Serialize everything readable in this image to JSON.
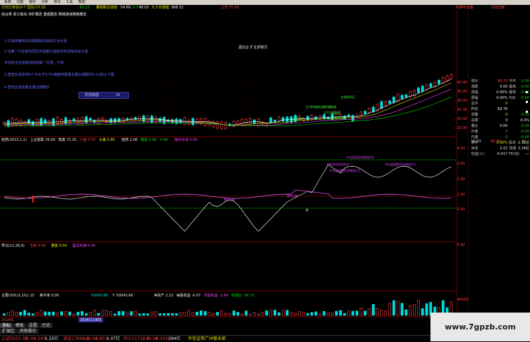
{
  "menu": [
    "系统",
    "功能",
    "报价",
    "分析",
    "资讯",
    "工具",
    "帮助"
  ],
  "titlebar": {
    "code_name": "方向万家信(0-7 国信)70.20",
    "change": "-62.21",
    "concept": "量锐新主动线",
    "price1": "54.69",
    "label2": "三十",
    "price2": "48.02",
    "label3": "九十日涨幅",
    "price3": "368.32",
    "state": "上日 75.65",
    "right_link": "实用平台版",
    "right_link2": "万向万家"
  },
  "subtitle": "综合类 浙江板块 涉矿概念 重组概念 网络游戏网络概念",
  "notes": [
    "1.只有政策利好的题题板块启动才会大涨",
    "2.当某一行业板块同比利润额大幅增长时该板块会大涨",
    "无利好无业绩板块启动是一日游，不追",
    "3.营收业绩增长6个点大于0.3%偶盘地量量业量台顺期印0.13倍以下量",
    "4.营收业绩增量业量台顺期印"
  ],
  "center_note": "酒店业 扩业梦破灭",
  "button_box": {
    "label": "厚层截图",
    "value": "35"
  },
  "chart_annotations": [
    "主力抄底超出最多最新底",
    "主力大幅抽高",
    "新不再生",
    "主力资金抽回",
    "庄家新多见"
  ],
  "price_axis": [
    "40.00",
    "35.00",
    "30.00",
    "25.00",
    "20.00",
    "15.00"
  ],
  "osc_axis": [
    "4.00",
    "3.00",
    "2.00",
    "1.00",
    "0.00"
  ],
  "osc_header": {
    "name": "趋势(2013,1,1)",
    "f1": "上证涨跌 76.00",
    "f2": "角度 72.35",
    "f3": "小盘 0.97",
    "f4": "大盘 0.95",
    "f5": "趋势 2.06",
    "f6": "量能 3.80",
    "f7": "3.40",
    "f8": "绝对长线 0.00"
  },
  "osc_labels": [
    "中长盘高资金增加信号",
    "机构资金进场加仓",
    "中长盘超跌资金增加信号",
    "中长盘超跌资金增加信号"
  ],
  "osc_small_labels": [
    "猪伤出屠",
    "猪伤出屠",
    "笑"
  ],
  "ind2_header": {
    "name": "乖马(12,26,9)",
    "f1": "五彩 0.00",
    "f2": "量能 0.00",
    "f3": "猛龙出海 0.00"
  },
  "ind2_axis": [
    "0.00"
  ],
  "vol_header": {
    "name": "主要(VOL(5,10)) 15",
    "f1": "换手率 0.00",
    "f2": "50043.66",
    "f3": "十 50043.66",
    "f4": "净资产 2.22",
    "f5": "每股收益 -0.07",
    "f6": "市盈收益 -1.84",
    "f7": "利润比 -34.72"
  },
  "vol_axis": [
    "40000"
  ],
  "date_axis": [
    "2014年",
    "2014/11/6日"
  ],
  "tabs": [
    "指标",
    "模板",
    "设置",
    "历史"
  ],
  "tabs2": [
    "扩展区",
    "关联报价"
  ],
  "side": {
    "rows": [
      {
        "k": "现价",
        "v": "69.78",
        "vc": "red",
        "k2": "今开",
        "v2": "-0.00",
        "v2c": "green"
      },
      {
        "k": "涨跌",
        "v": "0.00",
        "vc": "white",
        "k2": "最高",
        "v2": "-0.00",
        "v2c": "green"
      },
      {
        "k": "涨幅",
        "v": "0.00%",
        "vc": "white",
        "k2": "最低",
        "v2": "-0.00",
        "v2c": "green"
      },
      {
        "k": "振幅",
        "v": "0.00%",
        "vc": "white",
        "k2": "均价",
        "v2": "-0.00",
        "v2c": "green"
      },
      {
        "k": "总手",
        "v": "0",
        "vc": "yel",
        "k2": "",
        "v2": "",
        "v2c": "white"
      },
      {
        "k": "昨收",
        "v": "69.78",
        "vc": "white",
        "k2": "",
        "v2": "",
        "v2c": "white"
      },
      {
        "k": "现量",
        "v": "0",
        "vc": "yel",
        "k2": "",
        "v2": "-0.00",
        "v2c": "green"
      },
      {
        "k": "总额",
        "v": "0",
        "vc": "white",
        "k2": "",
        "v2": "0.0%",
        "v2c": "white"
      },
      {
        "k": "量比",
        "v": "0.00",
        "vc": "white",
        "k2": "",
        "v2": "-0.00",
        "v2c": "green"
      },
      {
        "k": "外盘",
        "v": "0",
        "vc": "red",
        "k2": "",
        "v2": "-0.00",
        "v2c": "green"
      },
      {
        "k": "内盘",
        "v": "0",
        "vc": "green",
        "k2": "",
        "v2": "-0.00",
        "v2c": "green"
      },
      {
        "k": "换手",
        "v": "0.00%",
        "vc": "yel",
        "k2": "股本",
        "v2": "2.18亿",
        "v2c": "white"
      },
      {
        "k": "净资",
        "v": "2.22",
        "vc": "white",
        "k2": "流通",
        "v2": "2.18亿",
        "v2c": "white"
      },
      {
        "k": "收益(三)",
        "v": "-0.017",
        "vc": "white",
        "k2": "PE(动)",
        "v2": "—",
        "v2c": "white"
      }
    ],
    "tick_time": "15:00",
    "tick_price": "69.78",
    "tick_vol": "0"
  },
  "status": {
    "sh": "上证5023.10",
    "sh_chg": "76.00",
    "sh_pct": "1.54%",
    "sh_amt": "1.25亿",
    "sz": "深证17649.1",
    "sz_chg": "148.04",
    "sz_pct": "0.85%",
    "sz_amt": "1.07亿",
    "zx": "中小11718.2",
    "zx_chg": "39.38",
    "zx_pct": "0.34%",
    "zx_amt": "394亿",
    "broker": "华信证券广州营业部"
  },
  "watermark": "www.7gpzb.com",
  "colors": {
    "up": "#ff4040",
    "down": "#00e0e0",
    "ma1": "#ffffff",
    "ma2": "#e0e000",
    "grid": "#7a0000",
    "note": "#6a6aff"
  }
}
